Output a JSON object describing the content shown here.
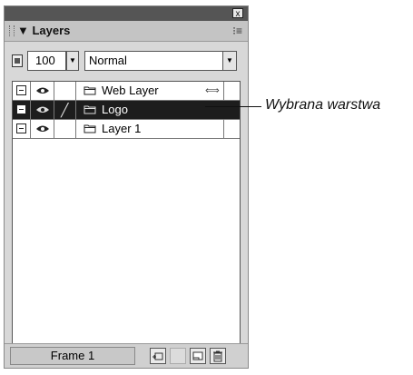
{
  "panel": {
    "close_label": "x",
    "title": "▼ Layers",
    "menu_glyph": "⁝≡"
  },
  "controls": {
    "opacity_value": "100",
    "blend_mode": "Normal",
    "dropdown_glyph": "▼"
  },
  "layers": [
    {
      "name": "Web Layer",
      "selected": false,
      "edit_icon": "",
      "arrow_icon": "⟺"
    },
    {
      "name": "Logo",
      "selected": true,
      "edit_icon": "pencil-icon"
    },
    {
      "name": "Layer 1",
      "selected": false,
      "edit_icon": ""
    }
  ],
  "bottom": {
    "frame_label": "Frame 1",
    "buttons": [
      "new-sublayer-icon",
      "placeholder-icon",
      "new-layer-icon",
      "trash-icon"
    ]
  },
  "callout": {
    "text": "Wybrana warstwa"
  }
}
